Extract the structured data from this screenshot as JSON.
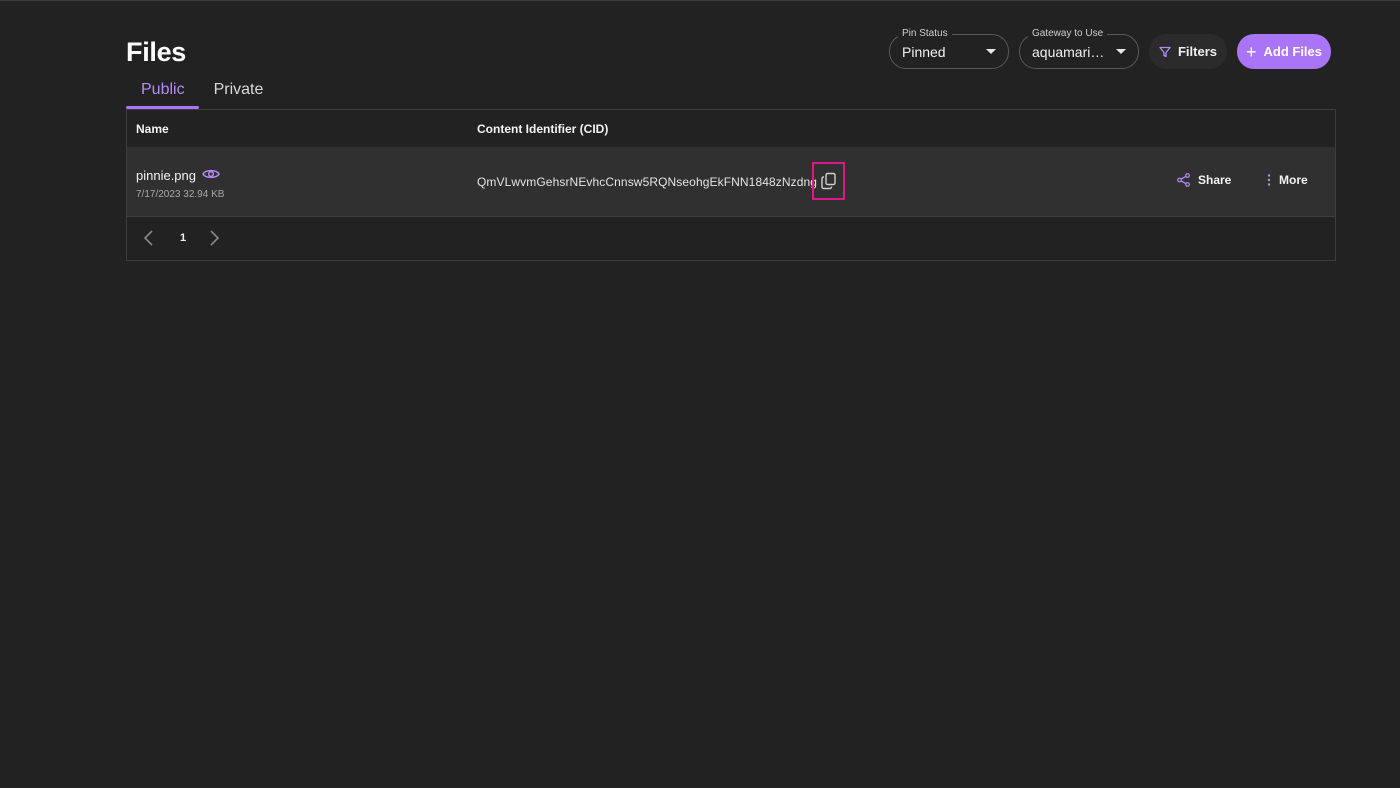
{
  "header": {
    "title": "Files"
  },
  "toolbar": {
    "pin_status": {
      "label": "Pin Status",
      "value": "Pinned"
    },
    "gateway": {
      "label": "Gateway to Use",
      "value": "aquamarin…"
    },
    "filters_label": "Filters",
    "add_files_label": "Add Files"
  },
  "tabs": [
    {
      "label": "Public",
      "active": true
    },
    {
      "label": "Private",
      "active": false
    }
  ],
  "table": {
    "columns": [
      "Name",
      "Content Identifier (CID)"
    ],
    "rows": [
      {
        "name": "pinnie.png",
        "meta": "7/17/2023 32.94 KB",
        "cid": "QmVLwvmGehsrNEvhcCnnsw5RQNseohgEkFNN1848zNzdng",
        "share_label": "Share",
        "more_label": "More"
      }
    ]
  },
  "pagination": {
    "current_page": "1"
  },
  "icons": {
    "eye": "eye-icon",
    "copy": "copy-icon",
    "share": "share-icon",
    "more": "more-vertical-icon",
    "filter": "filter-icon",
    "plus": "plus-icon",
    "prev": "chevron-left-icon",
    "next": "chevron-right-icon"
  },
  "colors": {
    "background": "#222222",
    "accent": "#a974f5",
    "highlight_box": "#e0168c",
    "row_background": "#303030"
  }
}
